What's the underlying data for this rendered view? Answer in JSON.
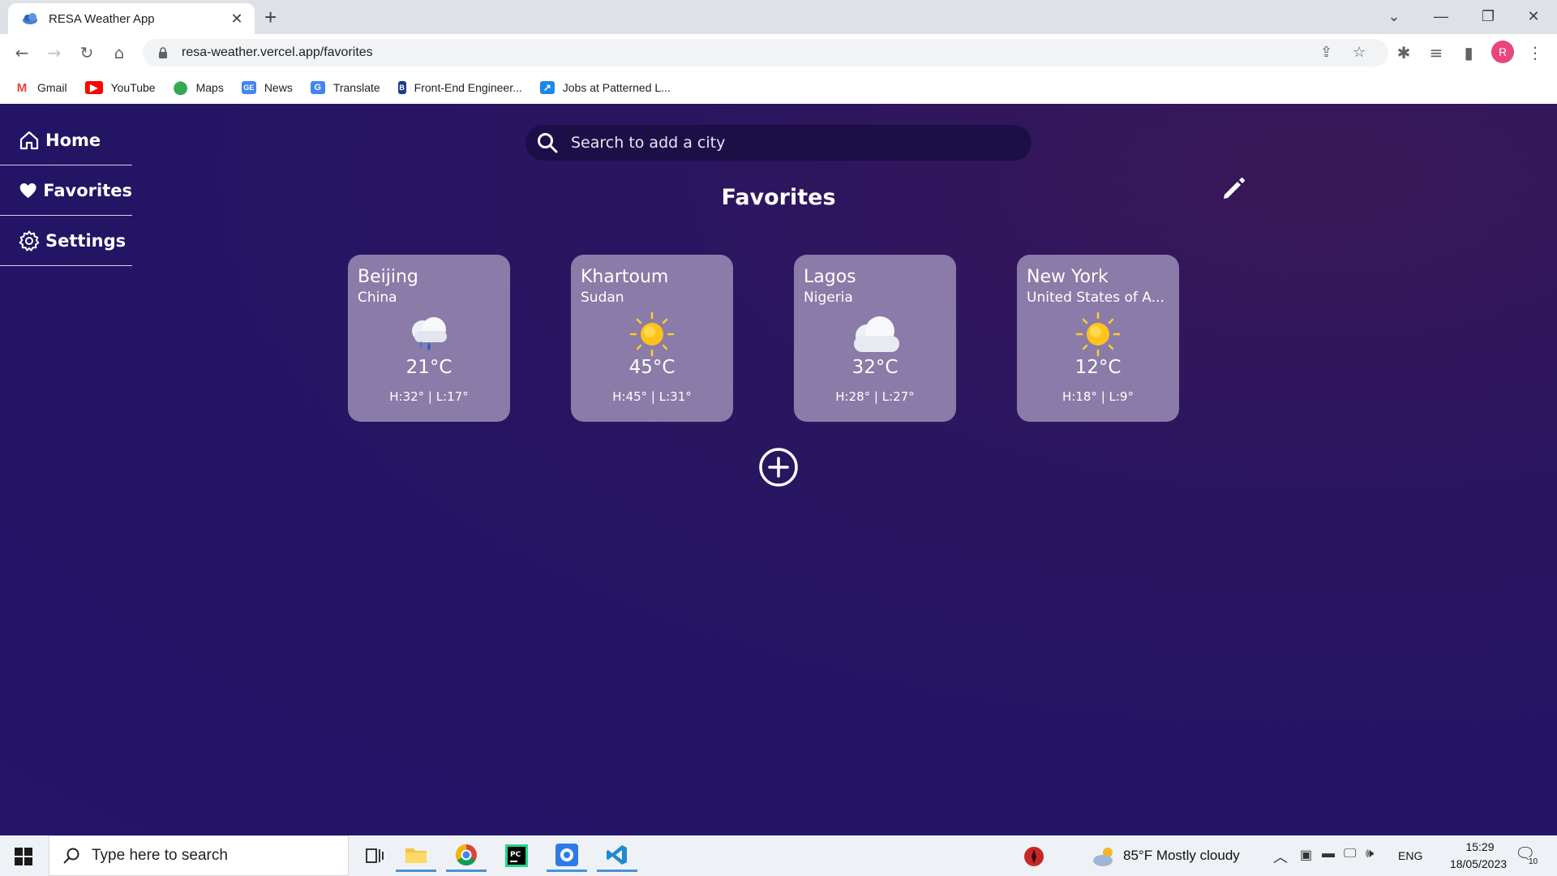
{
  "browser": {
    "tab_title": "RESA Weather App",
    "tab_close": "✕",
    "new_tab": "+",
    "url": "resa-weather.vercel.app/favorites",
    "bookmarks": [
      {
        "label": "Gmail",
        "color": "#ea4335"
      },
      {
        "label": "YouTube",
        "color": "#ff0000"
      },
      {
        "label": "Maps",
        "color": "#34a853"
      },
      {
        "label": "News",
        "color": "#4285f4"
      },
      {
        "label": "Translate",
        "color": "#4285f4"
      },
      {
        "label": "Front-End Engineer...",
        "color": "#1a3d8f"
      },
      {
        "label": "Jobs at Patterned L...",
        "color": "#1e88e5"
      }
    ],
    "profile_initial": "R"
  },
  "nav": {
    "items": [
      {
        "label": "Home",
        "icon": "home-icon"
      },
      {
        "label": "Favorites",
        "icon": "heart-icon"
      },
      {
        "label": "Settings",
        "icon": "gear-icon"
      }
    ]
  },
  "search": {
    "placeholder": "Search to add a city"
  },
  "page": {
    "title": "Favorites"
  },
  "favorites": [
    {
      "city": "Beijing",
      "country": "China",
      "condition_icon": "cloud-rain-icon",
      "temp": "21°C",
      "hi_lo": "H:32° | L:17°"
    },
    {
      "city": "Khartoum",
      "country": "Sudan",
      "condition_icon": "sun-icon",
      "temp": "45°C",
      "hi_lo": "H:45° | L:31°"
    },
    {
      "city": "Lagos",
      "country": "Nigeria",
      "condition_icon": "cloud-icon",
      "temp": "32°C",
      "hi_lo": "H:28° | L:27°"
    },
    {
      "city": "New York",
      "country": "United States of A...",
      "condition_icon": "sun-icon",
      "temp": "12°C",
      "hi_lo": "H:18° | L:9°"
    }
  ],
  "taskbar": {
    "search_placeholder": "Type here to search",
    "weather": "85°F  Mostly cloudy",
    "lang": "ENG",
    "time": "15:29",
    "date": "18/05/2023",
    "notifications": "10"
  },
  "colors": {
    "app_bg": "#25146a",
    "card_bg": "#8b7ba8",
    "search_bg": "#1c0f48"
  }
}
